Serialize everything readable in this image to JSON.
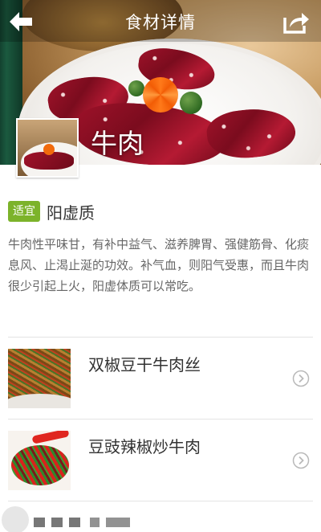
{
  "header": {
    "title": "食材详情",
    "back_icon": "back-arrow-icon",
    "share_icon": "share-icon"
  },
  "food": {
    "name": "牛肉",
    "suitable_badge": "适宜",
    "suitable_type": "阳虚质",
    "description": "牛肉性平味甘，有补中益气、滋养脾胃、强健筋骨、化痰息风、止渴止涎的功效。补气血，则阳气受惠，而且牛肉很少引起上火，阳虚体质可以常吃。"
  },
  "recipes": [
    {
      "name": "双椒豆干牛肉丝",
      "arrow_icon": "chevron-right-circle-icon"
    },
    {
      "name": "豆豉辣椒炒牛肉",
      "arrow_icon": "chevron-right-circle-icon"
    }
  ],
  "colors": {
    "badge_green": "#7cb32a",
    "text_dark": "#333333",
    "text_gray": "#666666",
    "divider": "#e4e4e4"
  }
}
